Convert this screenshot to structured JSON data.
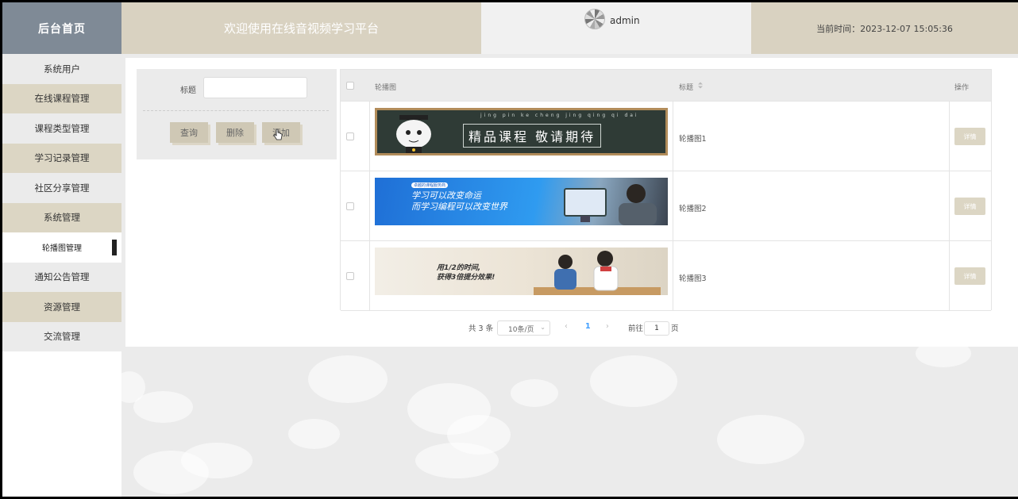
{
  "header": {
    "logo": "后台首页",
    "welcome": "欢迎使用在线音视频学习平台",
    "username": "admin",
    "current_time": "当前时间：2023-12-07 15:05:36"
  },
  "sidebar": {
    "items": [
      {
        "label": "系统用户"
      },
      {
        "label": "在线课程管理"
      },
      {
        "label": "课程类型管理"
      },
      {
        "label": "学习记录管理"
      },
      {
        "label": "社区分享管理"
      },
      {
        "label": "系统管理"
      },
      {
        "label": "轮播图管理"
      },
      {
        "label": "通知公告管理"
      },
      {
        "label": "资源管理"
      },
      {
        "label": "交流管理"
      }
    ]
  },
  "search": {
    "label": "标题",
    "value": "",
    "buttons": {
      "query": "查询",
      "delete": "删除",
      "add": "添加"
    }
  },
  "table": {
    "headers": {
      "image": "轮播图",
      "title": "标题",
      "action": "操作"
    },
    "rows": [
      {
        "title": "轮播图1",
        "action": "详情",
        "banner_text": "精品课程 敬请期待",
        "pinyin": "jing  pin  ke  cheng  jing  qing  qi  dai"
      },
      {
        "title": "轮播图2",
        "action": "详情",
        "banner_tag": "卓越的课程服务商",
        "banner_line1": "学习可以改变命运",
        "banner_line2": "而学习编程可以改变世界"
      },
      {
        "title": "轮播图3",
        "action": "详情",
        "banner_line1": "用1/2的时间,",
        "banner_line2": "获得3倍提分效果!"
      }
    ]
  },
  "pagination": {
    "total": "共 3 条",
    "page_size": "10条/页",
    "current_page": "1",
    "goto_label": "前往",
    "goto_value": "1",
    "page_suffix": "页"
  },
  "colors": {
    "accent_tan": "#d9d2c1",
    "logo_bg": "#7f8a96",
    "active_page": "#409eff"
  }
}
